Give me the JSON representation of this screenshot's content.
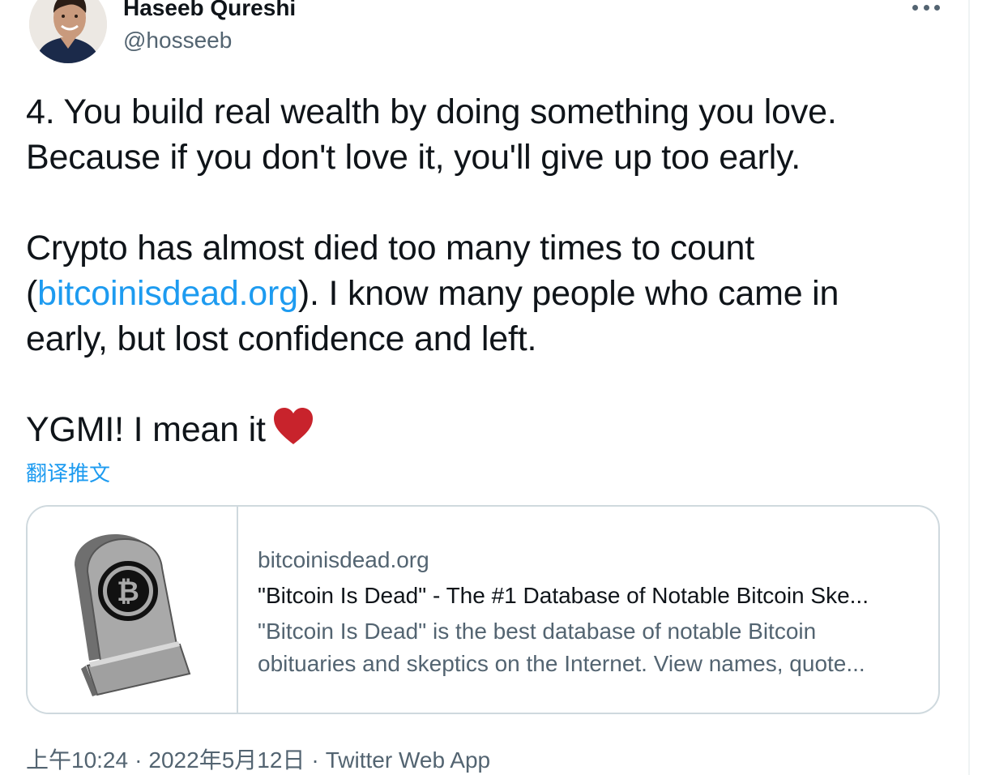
{
  "author": {
    "name": "Haseeb Qureshi",
    "handle": "@hosseeb"
  },
  "icons": {
    "more": "more-horizontal-icon",
    "heart": "red-heart-emoji",
    "card_image": "bitcoin-tombstone-icon"
  },
  "tweet": {
    "line1": "4. You build real wealth by doing something you love.",
    "line2": "Because if you don't love it, you'll give up too early.",
    "line3": "Crypto has almost died too many times to count",
    "line4_open": "(",
    "line4_link": "bitcoinisdead.org",
    "line4_rest": "). I know many people who came in",
    "line5": "early, but lost confidence and left.",
    "line6": "YGMI! I mean it"
  },
  "translate_label": "翻译推文",
  "card": {
    "domain": "bitcoinisdead.org",
    "title": "\"Bitcoin Is Dead\" - The #1 Database of Notable Bitcoin Ske...",
    "desc_line1": "\"Bitcoin Is Dead\" is the best database of notable Bitcoin",
    "desc_line2": "obituaries and skeptics on the Internet. View names, quote..."
  },
  "meta": {
    "time": "上午10:24",
    "separator": "·",
    "date": "2022年5月12日",
    "source": "Twitter Web App"
  },
  "colors": {
    "accent": "#1d9bf0",
    "text": "#0f1419",
    "secondary": "#536471",
    "border": "#cfd9de",
    "heart": "#c8232c"
  }
}
